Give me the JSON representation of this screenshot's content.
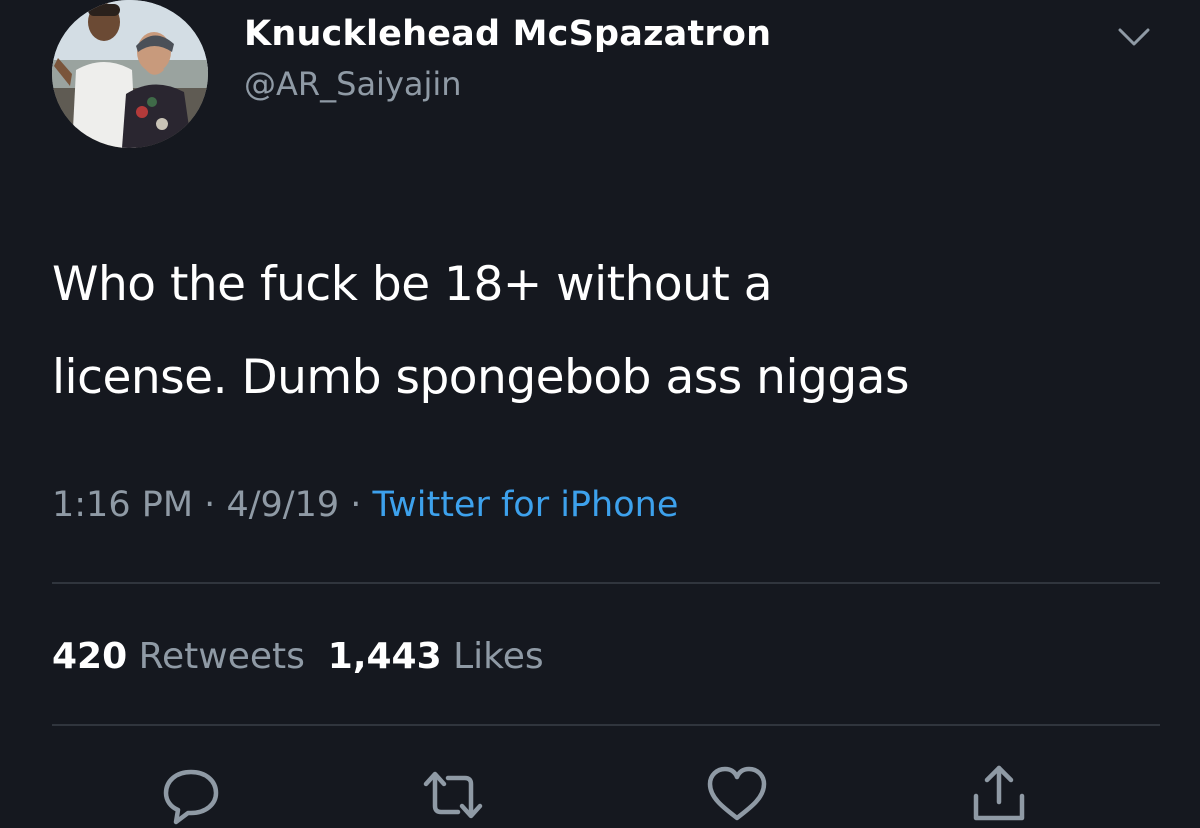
{
  "tweet": {
    "author": {
      "display_name": "Knucklehead McSpazatron",
      "handle": "@AR_Saiyajin",
      "avatar_icon": "profile-photo"
    },
    "text_lines": [
      "Who the fuck be 18+ without a",
      "license. Dumb spongebob ass niggas"
    ],
    "time": "1:16 PM",
    "separator": "·",
    "date": "4/9/19",
    "source": "Twitter for iPhone",
    "stats": {
      "retweets_count": "420",
      "retweets_label": "Retweets",
      "likes_count": "1,443",
      "likes_label": "Likes"
    },
    "actions": [
      {
        "name": "reply",
        "icon": "speech-bubble-icon"
      },
      {
        "name": "retweet",
        "icon": "retweet-arrows-icon"
      },
      {
        "name": "like",
        "icon": "heart-icon"
      },
      {
        "name": "share",
        "icon": "share-upload-icon"
      }
    ]
  },
  "colors": {
    "background": "#15181f",
    "primary_text": "#ffffff",
    "secondary_text": "#8f9aa5",
    "link": "#3da1ec",
    "divider": "#30353d"
  }
}
